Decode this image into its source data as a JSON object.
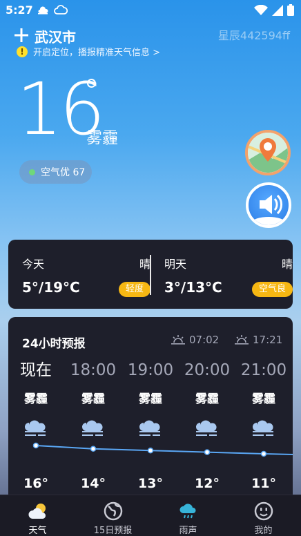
{
  "status": {
    "time": "5:27"
  },
  "header": {
    "city": "武汉市",
    "user_id": "星辰442594ff",
    "locate_tip": "开启定位，播报精准天气信息 >"
  },
  "current": {
    "temperature": "16",
    "condition": "雾霾",
    "aqi_text": "空气优 67"
  },
  "days": [
    {
      "label": "今天",
      "weather": "晴",
      "range": "5°/19°C",
      "badge": "轻度"
    },
    {
      "label": "明天",
      "weather": "晴",
      "range": "3°/13°C",
      "badge": "空气良"
    }
  ],
  "hourly": {
    "title": "24小时预报",
    "sunrise": "07:02",
    "sunset": "17:21",
    "items": [
      {
        "time": "现在",
        "cond": "雾霾",
        "temp": "16°",
        "value": 16
      },
      {
        "time": "18:00",
        "cond": "雾霾",
        "temp": "14°",
        "value": 14
      },
      {
        "time": "19:00",
        "cond": "雾霾",
        "temp": "13°",
        "value": 13
      },
      {
        "time": "20:00",
        "cond": "雾霾",
        "temp": "12°",
        "value": 12
      },
      {
        "time": "21:00",
        "cond": "雾霾",
        "temp": "11°",
        "value": 11
      }
    ]
  },
  "tabs": [
    {
      "label": "天气",
      "icon": "sun-cloud-icon",
      "active": true
    },
    {
      "label": "15日预报",
      "icon": "globe-icon",
      "active": false
    },
    {
      "label": "雨声",
      "icon": "rain-cloud-icon",
      "active": false
    },
    {
      "label": "我的",
      "icon": "smiley-icon",
      "active": false
    }
  ],
  "colors": {
    "card_bg": "#1e1f2b",
    "badge": "#f6b713",
    "line": "#5aa7f5"
  }
}
